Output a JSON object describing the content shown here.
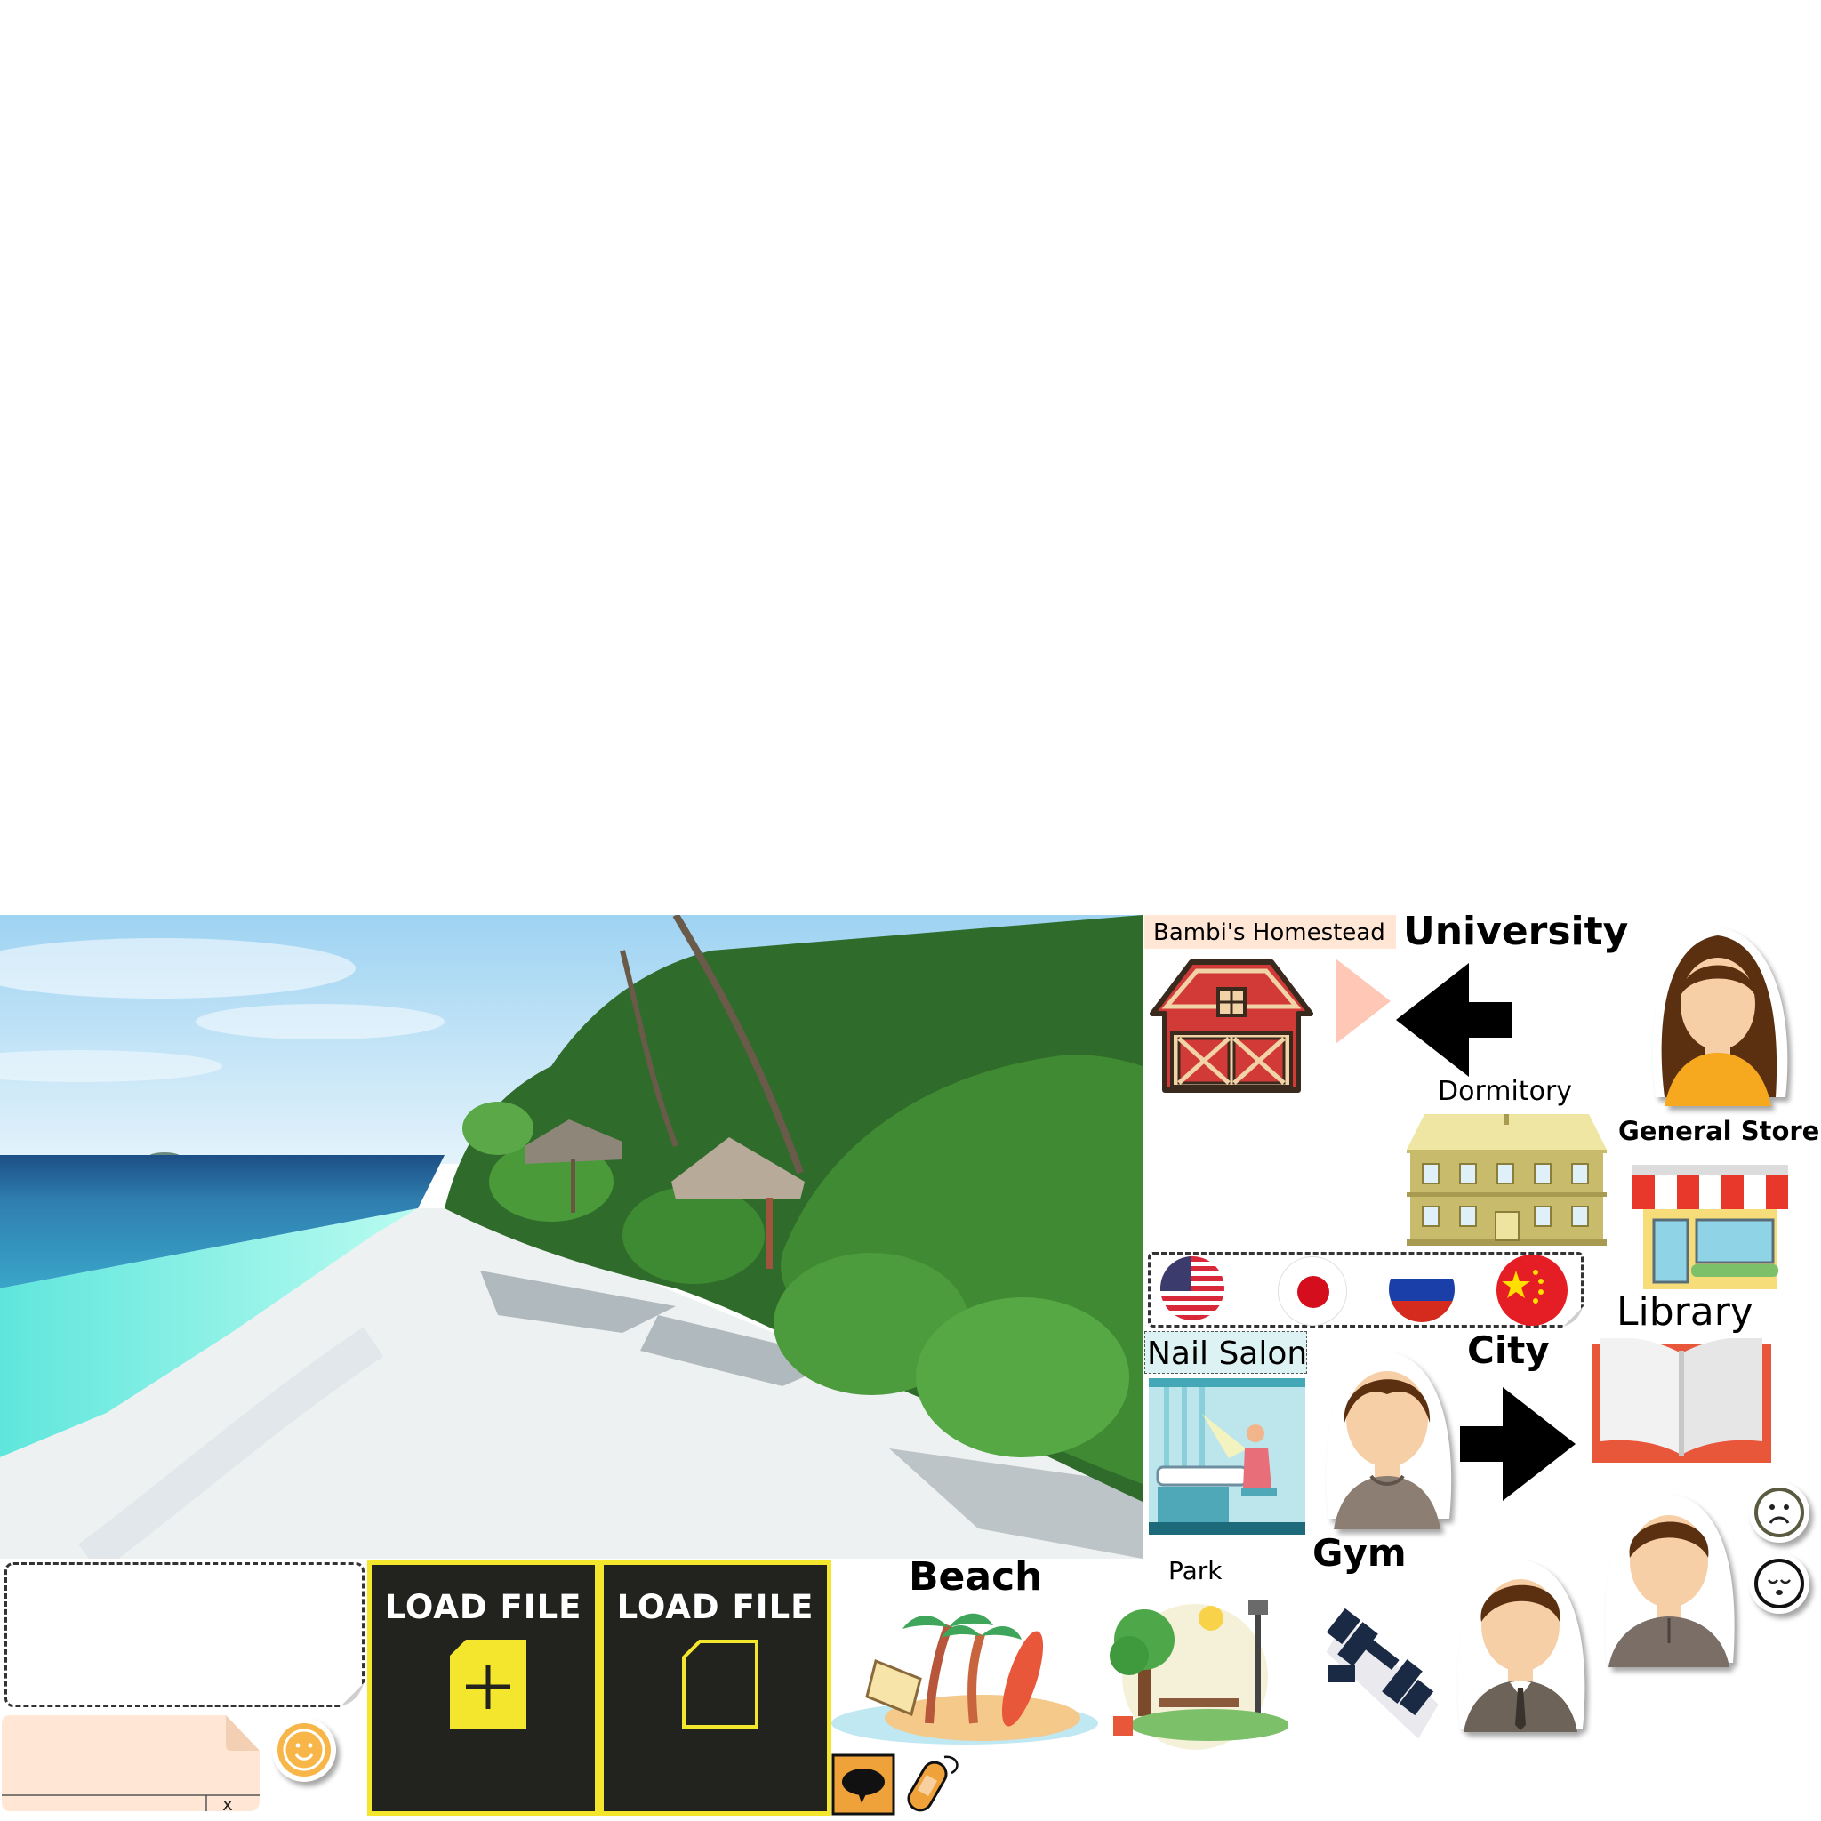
{
  "background": {
    "color": "#ffffff"
  },
  "colors": {
    "load_button_bg": "#22221e",
    "load_button_border": "#f4e62c",
    "note_panel_bg": "#ffe6d5",
    "homestead_label_bg": "#ffe6d5",
    "arrow": "#000000",
    "peach_arrow": "#ffc7b5"
  },
  "scene": {
    "name": "tropical-beach-photo"
  },
  "places": {
    "homestead": "Bambi's Homestead",
    "university": "University",
    "dormitory": "Dormitory",
    "general_store": "General Store",
    "library": "Library",
    "city": "City",
    "nail_salon": "Nail Salon",
    "gym": "Gym",
    "beach": "Beach",
    "park": "Park"
  },
  "buttons": {
    "load_file_new": "LOAD FILE",
    "load_file_open": "LOAD FILE"
  },
  "note_panel": {
    "close_label": "x"
  },
  "flags": [
    "usa-flag-icon",
    "japan-flag-icon",
    "russia-flag-icon",
    "china-flag-icon"
  ],
  "mood_icons": [
    "sad-face-icon",
    "sleepy-face-icon",
    "happy-face-icon"
  ]
}
